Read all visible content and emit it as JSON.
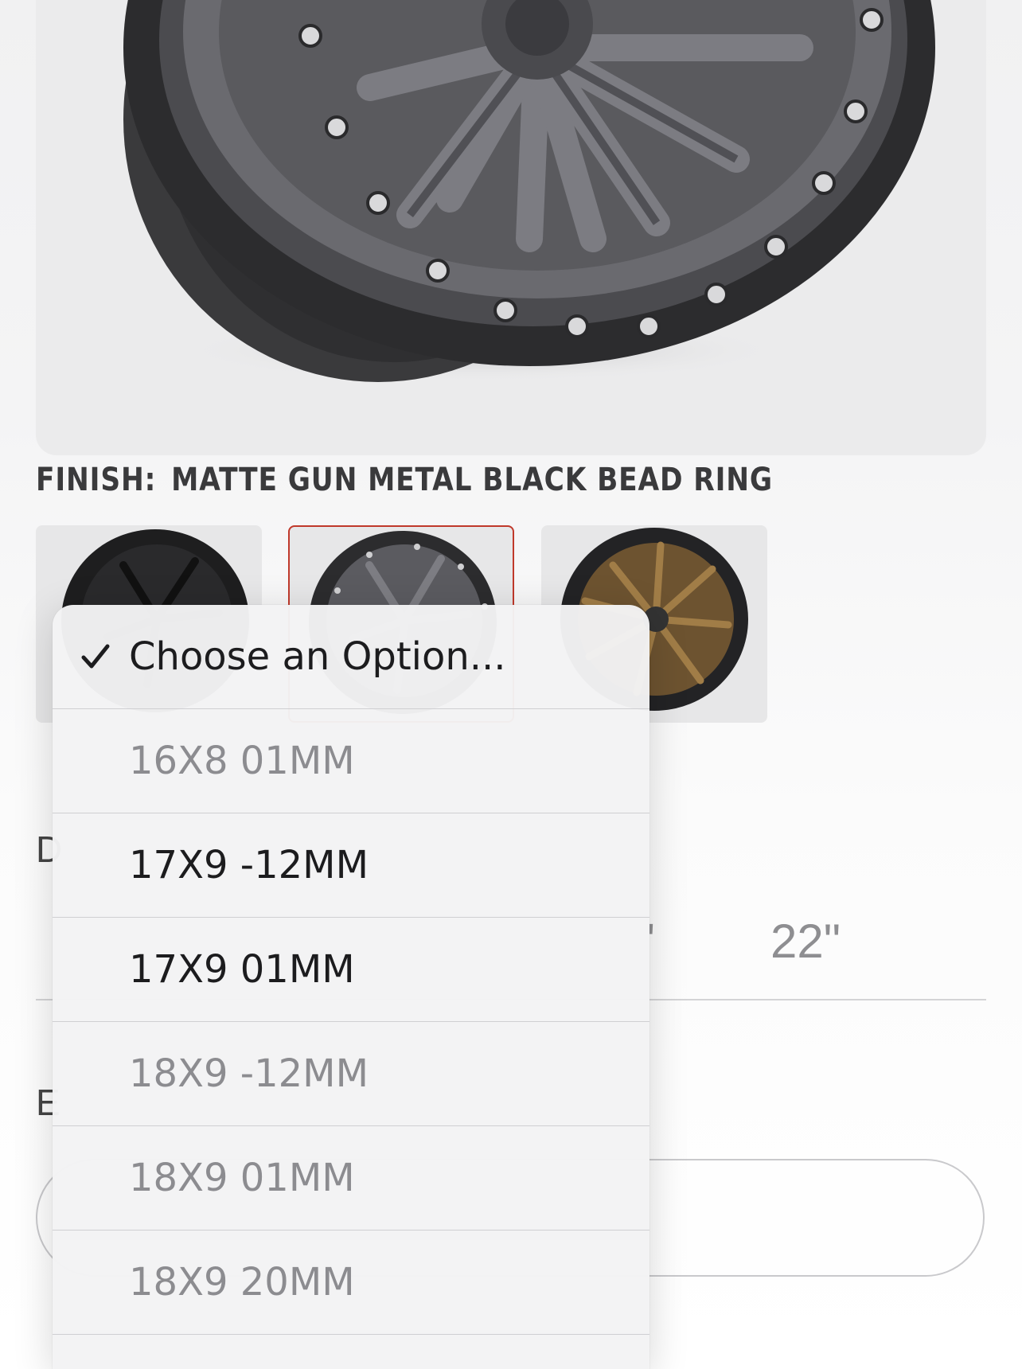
{
  "product": {
    "image_alt": "wheel-photo",
    "finish_label": "FINISH:",
    "finish_value": "MATTE GUN METAL BLACK BEAD RING"
  },
  "finish_swatches": [
    {
      "name": "matte-black",
      "selected": false
    },
    {
      "name": "matte-gun-metal-black-bead-ring",
      "selected": true
    },
    {
      "name": "bronze",
      "selected": false
    }
  ],
  "diameter_section": {
    "heading_fragment": "D",
    "tab_fragment": "'",
    "last_tab": "22\""
  },
  "second_section": {
    "heading_fragment": "E"
  },
  "select": {
    "options": [
      {
        "label": "Choose an Option...",
        "checked": true,
        "disabled": false
      },
      {
        "label": "16X8 01MM",
        "checked": false,
        "disabled": true
      },
      {
        "label": "17X9 -12MM",
        "checked": false,
        "disabled": false
      },
      {
        "label": "17X9 01MM",
        "checked": false,
        "disabled": false
      },
      {
        "label": "18X9 -12MM",
        "checked": false,
        "disabled": true
      },
      {
        "label": "18X9 01MM",
        "checked": false,
        "disabled": true
      },
      {
        "label": "18X9 20MM",
        "checked": false,
        "disabled": true
      }
    ]
  },
  "colors": {
    "selected_border": "#c0392b",
    "text_enabled": "#1c1c1e",
    "text_disabled": "#8c8c90"
  }
}
